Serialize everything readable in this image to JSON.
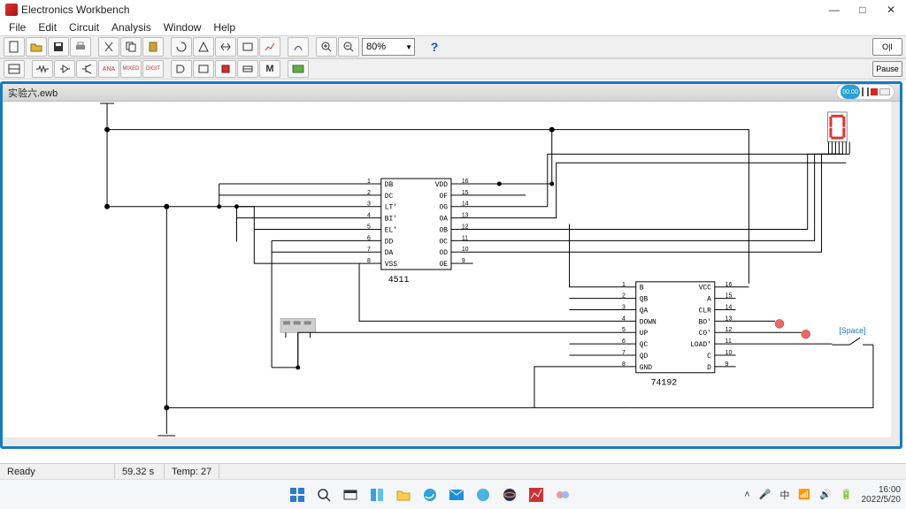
{
  "app": {
    "title": "Electronics Workbench"
  },
  "menu": {
    "file": "File",
    "edit": "Edit",
    "circuit": "Circuit",
    "analysis": "Analysis",
    "window": "Window",
    "help": "Help"
  },
  "toolbar": {
    "zoom_value": "80%",
    "help": "?",
    "sim_on": "O|I",
    "pause": "Pause"
  },
  "toolbar2": {
    "ana": "ANA",
    "mixed": "MIXED",
    "digit": "DIGIT",
    "m": "M"
  },
  "doc": {
    "filename": "实验六.ewb",
    "sim_time_badge": "00.00"
  },
  "chip1": {
    "name": "4511",
    "left_pins": [
      "DB",
      "DC",
      "LT'",
      "BI'",
      "EL'",
      "DD",
      "DA",
      "VSS"
    ],
    "left_nums": [
      "1",
      "2",
      "3",
      "4",
      "5",
      "6",
      "7",
      "8"
    ],
    "right_pins": [
      "VDD",
      "OF",
      "OG",
      "OA",
      "OB",
      "OC",
      "OD",
      "OE"
    ],
    "right_nums": [
      "16",
      "15",
      "14",
      "13",
      "12",
      "11",
      "10",
      "9"
    ]
  },
  "chip2": {
    "name": "74192",
    "left_pins": [
      "B",
      "QB",
      "QA",
      "DOWN",
      "UP",
      "QC",
      "QD",
      "GND"
    ],
    "left_nums": [
      "1",
      "2",
      "3",
      "4",
      "5",
      "6",
      "7",
      "8"
    ],
    "right_pins": [
      "VCC",
      "A",
      "CLR",
      "BO'",
      "CO'",
      "LOAD'",
      "C",
      "D"
    ],
    "right_nums": [
      "16",
      "15",
      "14",
      "13",
      "12",
      "11",
      "10",
      "9"
    ]
  },
  "switch_label": "[Space]",
  "status": {
    "ready": "Ready",
    "time": "59.32 s",
    "temp": "Temp:  27"
  },
  "taskbar": {
    "time": "16:00",
    "date": "2022/5/20",
    "lang": "中"
  }
}
